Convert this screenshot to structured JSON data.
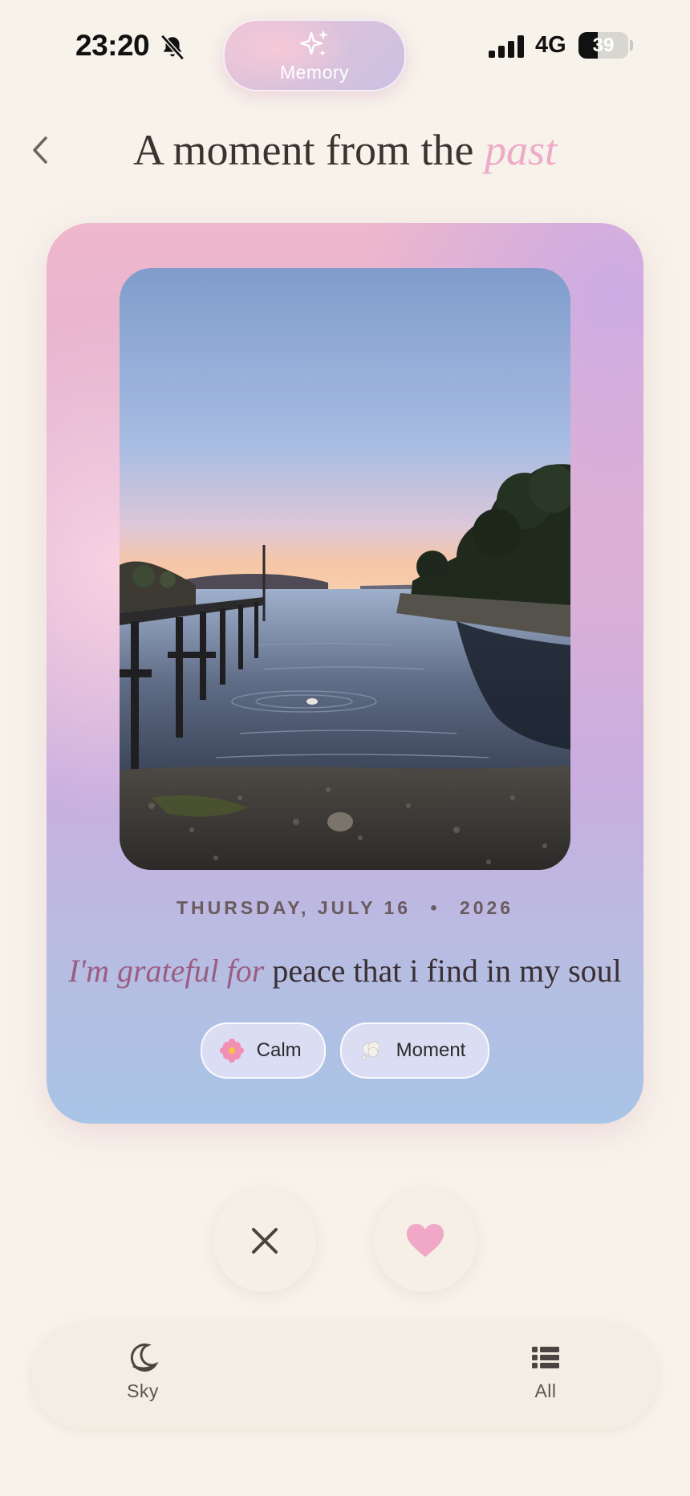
{
  "status_bar": {
    "time": "23:20",
    "network": "4G",
    "battery": "39",
    "battery_fraction": 0.39
  },
  "header": {
    "title_main": "A moment from the",
    "title_accent": "past"
  },
  "memory": {
    "date_day": "THURSDAY, JULY 16",
    "date_separator": "•",
    "date_year": "2026",
    "prefix": "I'm grateful for",
    "text": "peace that i find in my soul",
    "tags": [
      {
        "label": "Calm",
        "icon": "flower-icon"
      },
      {
        "label": "Moment",
        "icon": "thought-bubble-icon"
      }
    ]
  },
  "actions": {
    "dismiss_icon": "close-icon",
    "favorite_icon": "heart-icon",
    "favorite_color": "#f0a8c6"
  },
  "tabs": [
    {
      "label": "Sky",
      "icon": "moon-icon"
    },
    {
      "label": "Memory",
      "icon": "sparkles-icon"
    },
    {
      "label": "All",
      "icon": "list-icon"
    }
  ],
  "colors": {
    "background": "#f7f3ea",
    "accent_pink": "#efaac8",
    "prefix_mauve": "#9b5d83"
  }
}
